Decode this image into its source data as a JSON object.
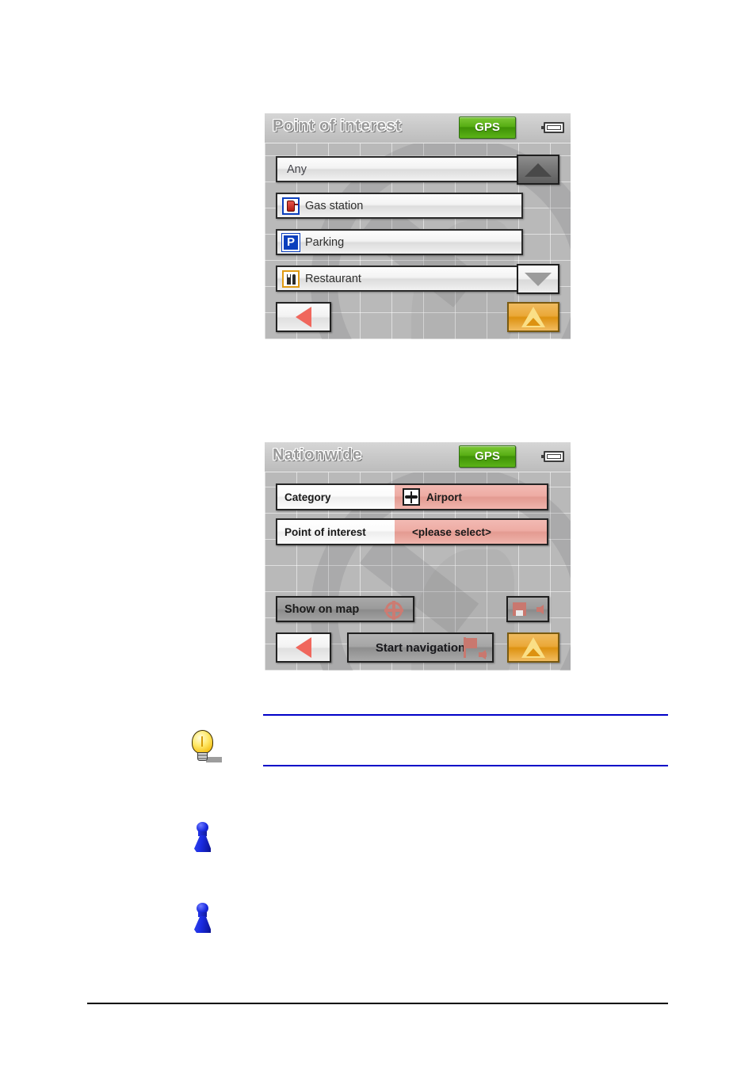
{
  "document": {
    "type": "navigation-device-manual-page",
    "has_footer_rule": true
  },
  "screen_poi": {
    "title": "Point of interest",
    "status": {
      "gps_label": "GPS",
      "gps_color": "#57ad13",
      "battery_icon": "battery-icon"
    },
    "rows": [
      {
        "label": "Any",
        "icon": null
      },
      {
        "label": "Gas station",
        "icon": "gas-station-icon"
      },
      {
        "label": "Parking",
        "icon": "parking-icon"
      },
      {
        "label": "Restaurant",
        "icon": "restaurant-icon"
      }
    ],
    "parking_icon_letter": "P",
    "scroll": {
      "up_icon": "arrow-up-icon",
      "down_icon": "arrow-down-icon"
    },
    "footer": {
      "back_icon": "back-arrow-icon",
      "navigate_icon": "navigation-cursor-icon"
    }
  },
  "screen_nationwide": {
    "title": "Nationwide",
    "status": {
      "gps_label": "GPS",
      "gps_color": "#57ad13",
      "battery_icon": "battery-icon"
    },
    "fields": [
      {
        "label": "Category",
        "value": "Airport",
        "icon": "airplane-icon"
      },
      {
        "label": "Point of interest",
        "value": "<please select>",
        "icon": null
      }
    ],
    "actions": {
      "show_on_map_label": "Show on map",
      "show_on_map_icon": "crosshair-icon",
      "save_icon": "save-destination-icon",
      "start_navigation_label": "Start navigation",
      "start_navigation_icon": "finish-flag-icon"
    },
    "footer": {
      "back_icon": "back-arrow-icon",
      "navigate_icon": "navigation-cursor-icon"
    },
    "accent_color": "#e39a91"
  },
  "notes": [
    {
      "icon": "lightbulb-tip-icon",
      "rule_color": "#0000c8",
      "text": ""
    },
    {
      "icon": "blue-pawn-icon",
      "text": ""
    },
    {
      "icon": "blue-pawn-icon",
      "text": ""
    }
  ]
}
